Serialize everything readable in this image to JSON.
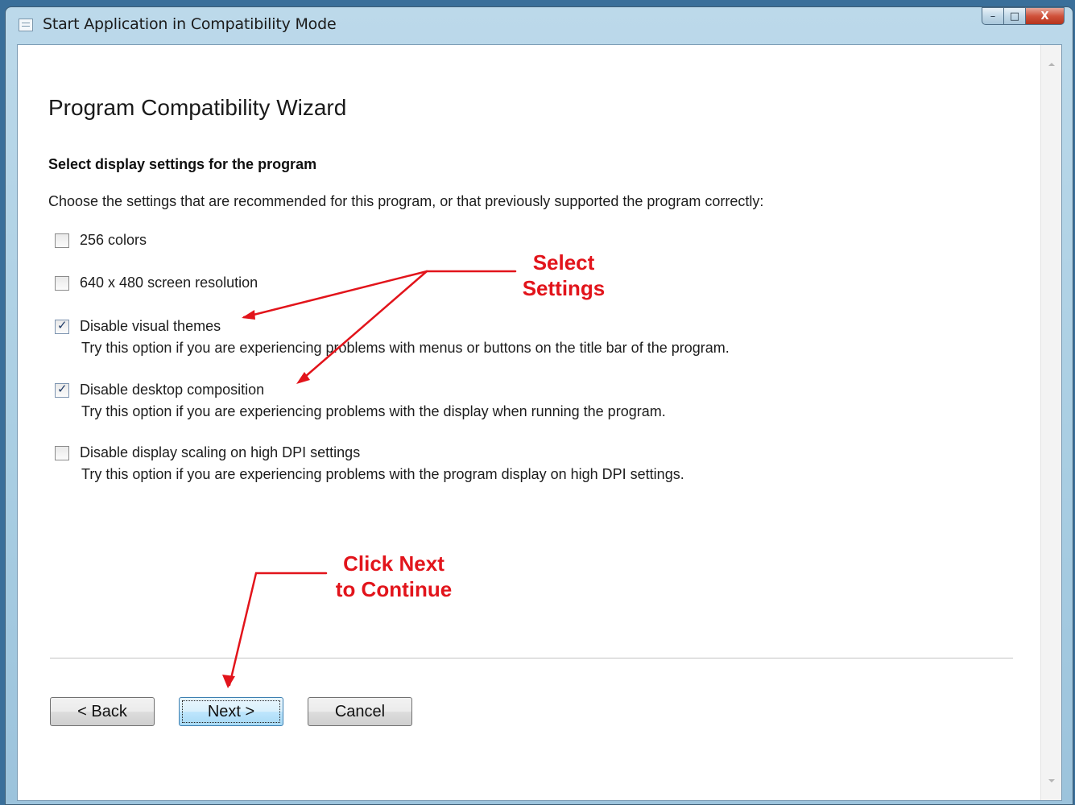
{
  "window": {
    "title": "Start Application in Compatibility Mode",
    "minimize_glyph": "–",
    "maximize_glyph": "□",
    "close_glyph": "X"
  },
  "wizard": {
    "heading": "Program Compatibility Wizard",
    "subheading": "Select display settings for the program",
    "intro": "Choose the settings that are recommended for this program, or that previously supported the program correctly:"
  },
  "options": [
    {
      "label": "256 colors",
      "checked": false,
      "description": ""
    },
    {
      "label": "640 x 480 screen resolution",
      "checked": false,
      "description": ""
    },
    {
      "label": "Disable visual themes",
      "checked": true,
      "description": "Try this option if you are experiencing problems with menus or buttons on the title bar of the program."
    },
    {
      "label": "Disable desktop composition",
      "checked": true,
      "description": "Try this option if you are experiencing problems with the display when running the program."
    },
    {
      "label": "Disable display scaling on high DPI settings",
      "checked": false,
      "description": "Try this option if you are experiencing problems with the program display on high DPI settings."
    }
  ],
  "buttons": {
    "back": "< Back",
    "next": "Next >",
    "cancel": "Cancel"
  },
  "annotations": {
    "select_line1": "Select",
    "select_line2": "Settings",
    "next_line1": "Click Next",
    "next_line2": "to Continue",
    "color": "#e2141b"
  },
  "icons": {
    "app": "window-icon",
    "scroll_up": "scroll-up-arrow",
    "scroll_down": "scroll-down-arrow"
  }
}
